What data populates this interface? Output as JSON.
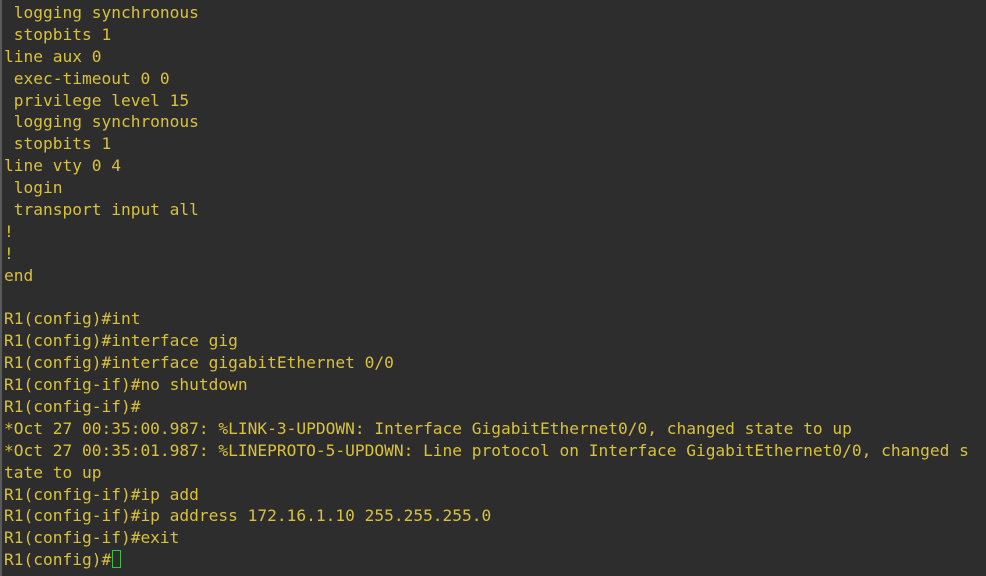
{
  "terminal": {
    "text_color": "#d8c13c",
    "background_color": "#2d2d2d",
    "cursor_color": "#38c24a",
    "lines": [
      " logging synchronous",
      " stopbits 1",
      "line aux 0",
      " exec-timeout 0 0",
      " privilege level 15",
      " logging synchronous",
      " stopbits 1",
      "line vty 0 4",
      " login",
      " transport input all",
      "!",
      "!",
      "end",
      "",
      "R1(config)#int",
      "R1(config)#interface gig",
      "R1(config)#interface gigabitEthernet 0/0",
      "R1(config-if)#no shutdown",
      "R1(config-if)#",
      "*Oct 27 00:35:00.987: %LINK-3-UPDOWN: Interface GigabitEthernet0/0, changed state to up",
      "*Oct 27 00:35:01.987: %LINEPROTO-5-UPDOWN: Line protocol on Interface GigabitEthernet0/0, changed s",
      "tate to up",
      "R1(config-if)#ip add",
      "R1(config-if)#ip address 172.16.1.10 255.255.255.0",
      "R1(config-if)#exit"
    ],
    "prompt": "R1(config)#",
    "cursor_icon": "block-cursor"
  }
}
